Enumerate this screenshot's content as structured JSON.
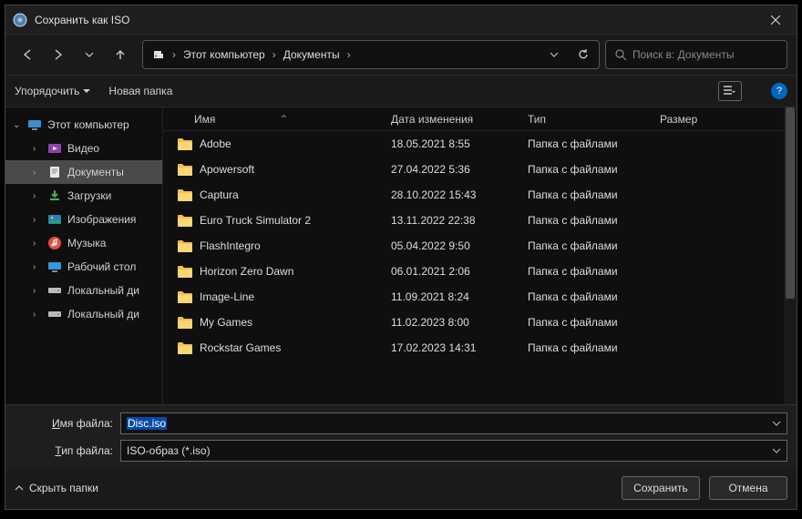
{
  "title": "Сохранить как ISO",
  "breadcrumb": {
    "root": "Этот компьютер",
    "folder": "Документы"
  },
  "search": {
    "placeholder": "Поиск в: Документы"
  },
  "toolbar": {
    "organize": "Упорядочить",
    "newfolder": "Новая папка"
  },
  "tree": {
    "root": "Этот компьютер",
    "items": [
      {
        "label": "Видео"
      },
      {
        "label": "Документы",
        "selected": true
      },
      {
        "label": "Загрузки"
      },
      {
        "label": "Изображения"
      },
      {
        "label": "Музыка"
      },
      {
        "label": "Рабочий стол"
      },
      {
        "label": "Локальный ди"
      },
      {
        "label": "Локальный ди"
      }
    ]
  },
  "columns": {
    "name": "Имя",
    "date": "Дата изменения",
    "type": "Тип",
    "size": "Размер"
  },
  "rows": [
    {
      "name": "Adobe",
      "date": "18.05.2021 8:55",
      "type": "Папка с файлами"
    },
    {
      "name": "Apowersoft",
      "date": "27.04.2022 5:36",
      "type": "Папка с файлами"
    },
    {
      "name": "Captura",
      "date": "28.10.2022 15:43",
      "type": "Папка с файлами"
    },
    {
      "name": "Euro Truck Simulator 2",
      "date": "13.11.2022 22:38",
      "type": "Папка с файлами"
    },
    {
      "name": "FlashIntegro",
      "date": "05.04.2022 9:50",
      "type": "Папка с файлами"
    },
    {
      "name": "Horizon Zero Dawn",
      "date": "06.01.2021 2:06",
      "type": "Папка с файлами"
    },
    {
      "name": "Image-Line",
      "date": "11.09.2021 8:24",
      "type": "Папка с файлами"
    },
    {
      "name": "My Games",
      "date": "11.02.2023 8:00",
      "type": "Папка с файлами"
    },
    {
      "name": "Rockstar Games",
      "date": "17.02.2023 14:31",
      "type": "Папка с файлами"
    }
  ],
  "filename": {
    "label": "Имя файла:",
    "value": "Disc.iso"
  },
  "filetype": {
    "label": "Тип файла:",
    "value": "ISO-образ (*.iso)"
  },
  "hide": "Скрыть папки",
  "buttons": {
    "save": "Сохранить",
    "cancel": "Отмена"
  }
}
